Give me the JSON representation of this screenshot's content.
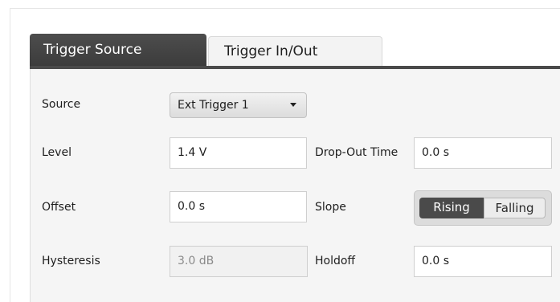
{
  "tabs": [
    {
      "label": "Trigger Source",
      "active": true
    },
    {
      "label": "Trigger In/Out",
      "active": false
    }
  ],
  "source": {
    "label": "Source",
    "value": "Ext Trigger 1"
  },
  "level": {
    "label": "Level",
    "value": "1.4 V"
  },
  "offset": {
    "label": "Offset",
    "value": "0.0 s"
  },
  "hysteresis": {
    "label": "Hysteresis",
    "value": "3.0 dB",
    "enabled": false
  },
  "dropout_time": {
    "label": "Drop-Out Time",
    "value": "0.0 s"
  },
  "slope": {
    "label": "Slope",
    "options": [
      "Rising",
      "Falling"
    ],
    "selected": "Rising"
  },
  "holdoff": {
    "label": "Holdoff",
    "value": "0.0 s"
  },
  "colors": {
    "active_tab": "#444444",
    "panel": "#f5f5f5",
    "segment_on": "#4a4a4a"
  }
}
